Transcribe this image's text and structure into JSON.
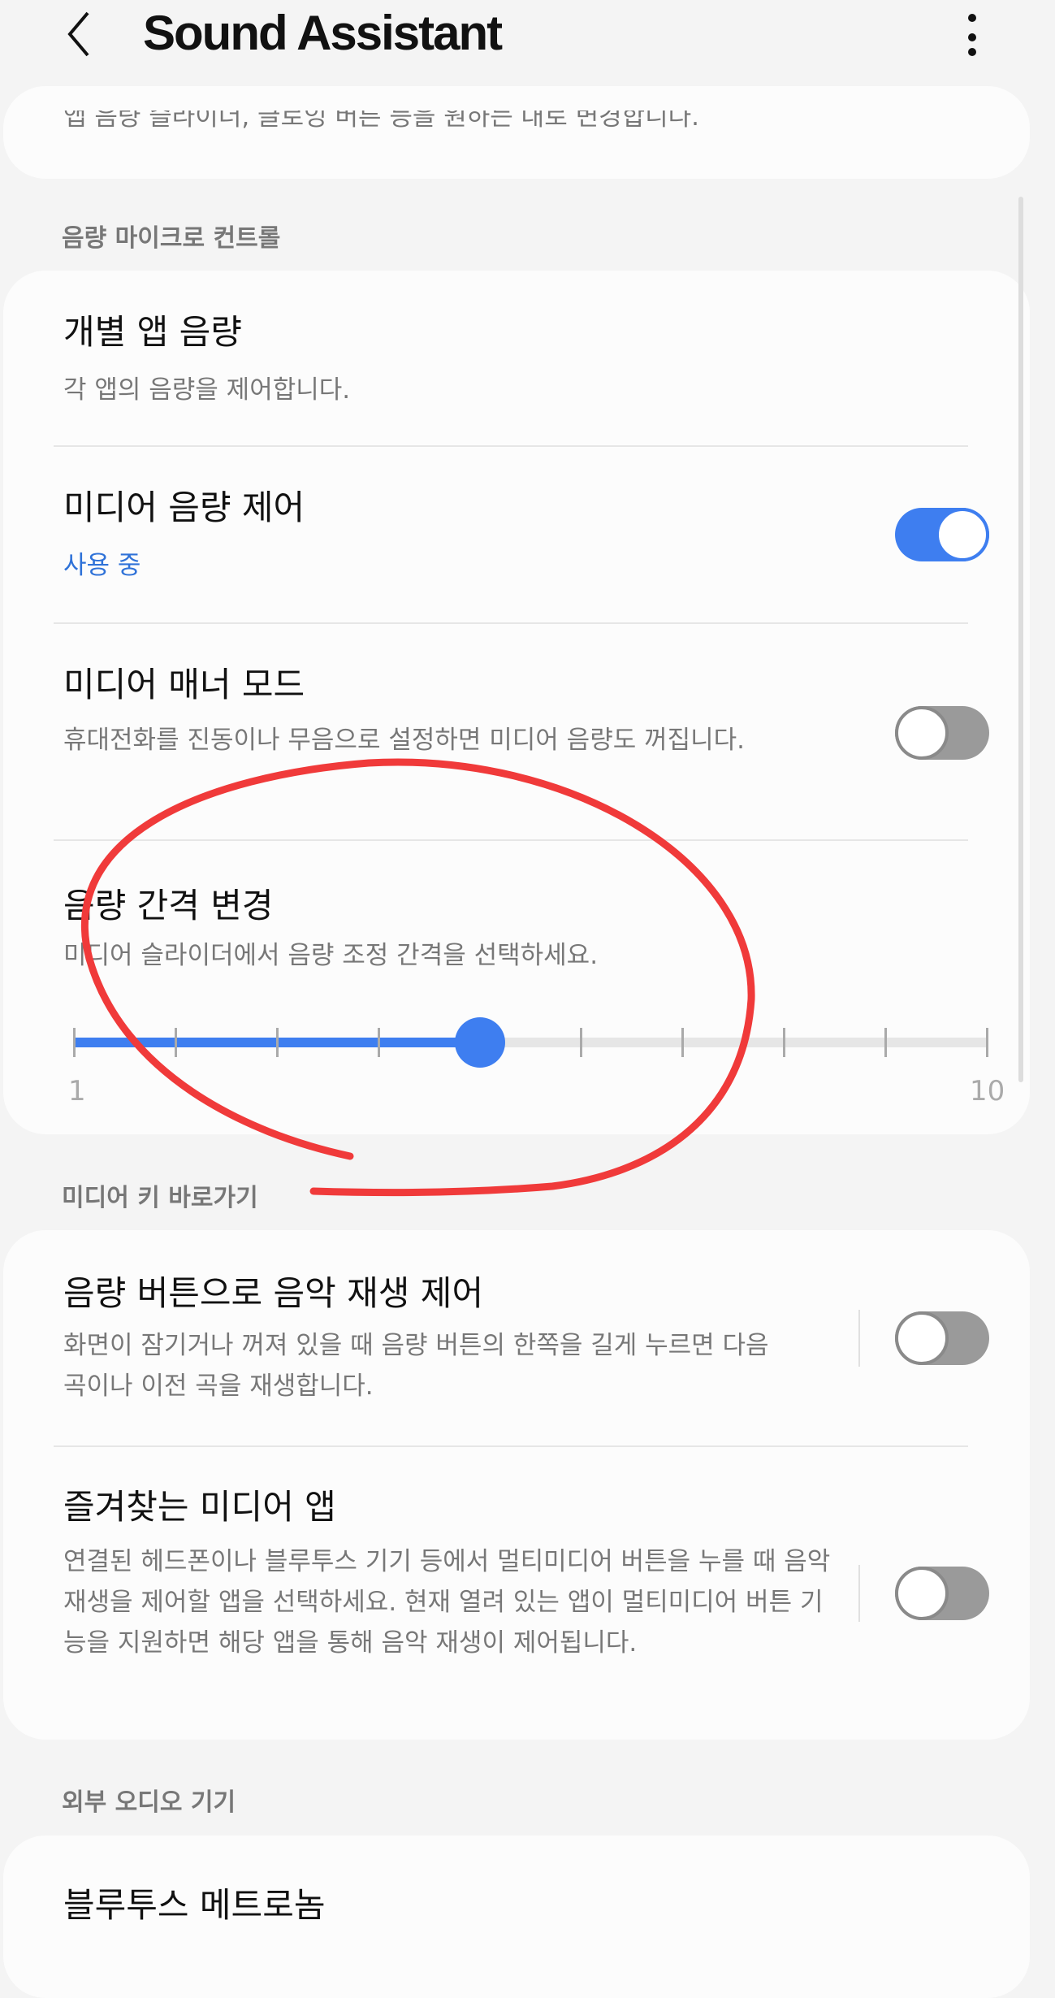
{
  "header": {
    "title": "Sound Assistant",
    "back_icon": "chevron-left-icon",
    "more_icon": "more-vertical-icon"
  },
  "top_card": {
    "partial_text": "앱 음량 슬라이더, 글로잉 버튼 등을 원하는 대로 변경합니다."
  },
  "sections": [
    {
      "header": "음량 마이크로 컨트롤",
      "items": [
        {
          "title": "개별 앱 음량",
          "subtitle": "각 앱의 음량을 제어합니다."
        },
        {
          "title": "미디어 음량 제어",
          "subtitle": "사용 중",
          "toggle": true
        },
        {
          "title": "미디어 매너 모드",
          "subtitle": "휴대전화를 진동이나 무음으로 설정하면 미디어 음량도 꺼집니다.",
          "toggle": false
        },
        {
          "title": "음량 간격 변경",
          "subtitle": "미디어 슬라이더에서 음량 조정 간격을 선택하세요.",
          "slider": {
            "min": 1,
            "max": 10,
            "value": 5,
            "min_label": "1",
            "max_label": "10"
          }
        }
      ]
    },
    {
      "header": "미디어 키 바로가기",
      "items": [
        {
          "title": "음량 버튼으로 음악 재생 제어",
          "subtitle": "화면이 잠기거나 꺼져 있을 때 음량 버튼의 한쪽을 길게 누르면 다음 곡이나 이전 곡을 재생합니다.",
          "toggle": false
        },
        {
          "title": "즐겨찾는 미디어 앱",
          "subtitle": "연결된 헤드폰이나 블루투스 기기 등에서 멀티미디어 버튼을 누를 때 음악 재생을 제어할 앱을 선택하세요. 현재 열려 있는 앱이 멀티미디어 버튼 기능을 지원하면 해당 앱을 통해 음악 재생이 제어됩니다.",
          "toggle": false
        }
      ]
    },
    {
      "header": "외부 오디오 기기",
      "items": [
        {
          "title": "블루투스 메트로놈"
        }
      ]
    }
  ],
  "colors": {
    "accent": "#3e7ef0",
    "annotation": "#f03a3a"
  }
}
